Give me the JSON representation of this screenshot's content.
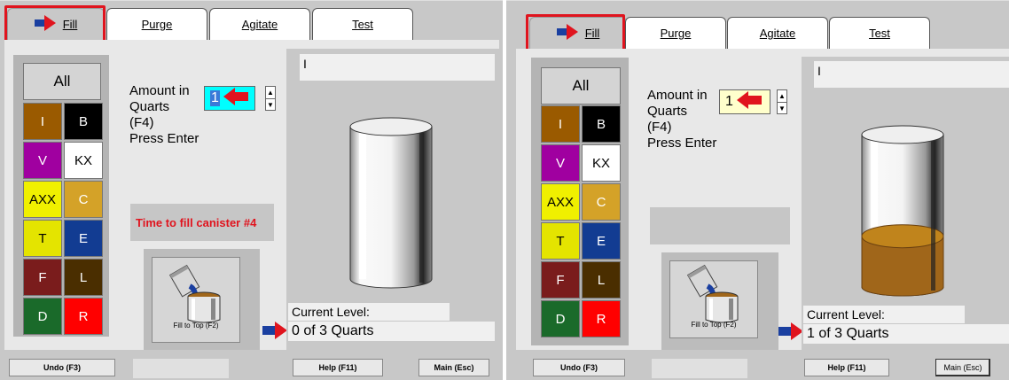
{
  "tabs": [
    {
      "label": "Fill"
    },
    {
      "label": "Purge"
    },
    {
      "label": "Agitate"
    },
    {
      "label": "Test"
    }
  ],
  "colors": {
    "accent_red": "#e0141e",
    "highlight_cyan": "#00ffff",
    "highlight_yellow": "#ffffcc",
    "paint_brown": "#a0661a"
  },
  "palette": {
    "all_label": "All",
    "cells": [
      {
        "label": "I",
        "bg": "#9a5a00",
        "fg": "#ffffff"
      },
      {
        "label": "B",
        "bg": "#000000",
        "fg": "#ffffff"
      },
      {
        "label": "V",
        "bg": "#a000a0",
        "fg": "#ffffff"
      },
      {
        "label": "KX",
        "bg": "#ffffff",
        "fg": "#000000"
      },
      {
        "label": "AXX",
        "bg": "#f0f000",
        "fg": "#000000"
      },
      {
        "label": "C",
        "bg": "#d4a228",
        "fg": "#ffffff"
      },
      {
        "label": "T",
        "bg": "#e4e400",
        "fg": "#000000"
      },
      {
        "label": "E",
        "bg": "#123c92",
        "fg": "#ffffff"
      },
      {
        "label": "F",
        "bg": "#7a1c1c",
        "fg": "#ffffff"
      },
      {
        "label": "L",
        "bg": "#4a2e00",
        "fg": "#ffffff"
      },
      {
        "label": "D",
        "bg": "#1a6a2a",
        "fg": "#ffffff"
      },
      {
        "label": "R",
        "bg": "#ff0000",
        "fg": "#ffffff"
      }
    ]
  },
  "amount_prompt": {
    "line1": "Amount in",
    "line2": "Quarts",
    "line3": "(F4)",
    "line4": "Press Enter"
  },
  "panels": [
    {
      "amount_value": "1",
      "message": "Time to fill canister #4",
      "top_field": "I",
      "current_level_label": "Current Level:",
      "status": "0 of 3 Quarts",
      "fill_level": 0
    },
    {
      "amount_value": "1",
      "message": "",
      "top_field": "I",
      "current_level_label": "Current Level:",
      "status": "1 of 3 Quarts",
      "fill_level": 0.333
    }
  ],
  "fill_button": {
    "label": "Fill to Top (F2)"
  },
  "buttons": {
    "undo": "Undo (F3)",
    "help": "Help (F11)",
    "main": "Main (Esc)"
  }
}
